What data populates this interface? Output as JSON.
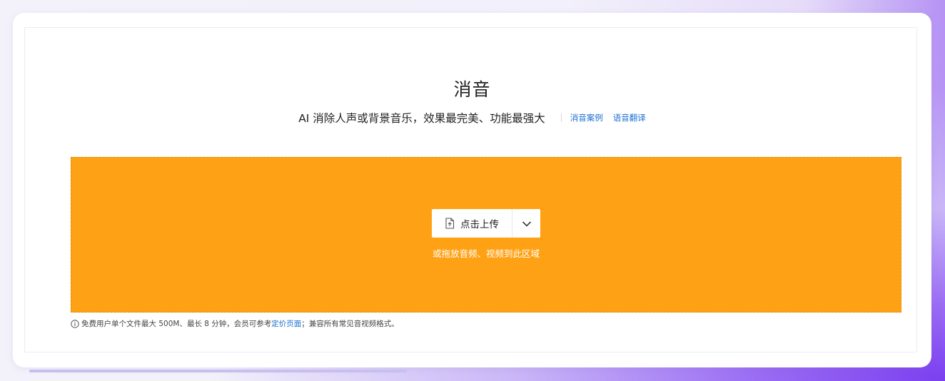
{
  "header": {
    "title": "消音",
    "subtitle": "AI 消除人声或背景音乐，效果最完美、功能最强大",
    "links": [
      {
        "label": "消音案例"
      },
      {
        "label": "语音翻译"
      }
    ]
  },
  "upload": {
    "button_label": "点击上传",
    "button_icon": "file-upload-icon",
    "dropdown_icon": "chevron-down-icon",
    "drop_hint": "或拖放音频、视频到此区域",
    "zone_color": "#ffa114"
  },
  "notice": {
    "icon": "info-icon",
    "text_before": "免费用户单个文件最大 500M、最长 8 分钟，会员可参考",
    "link_label": "定价页面",
    "text_after": "；兼容所有常见音视频格式。"
  },
  "colors": {
    "accent_link": "#1a6fd1",
    "upload_zone": "#ffa114"
  }
}
